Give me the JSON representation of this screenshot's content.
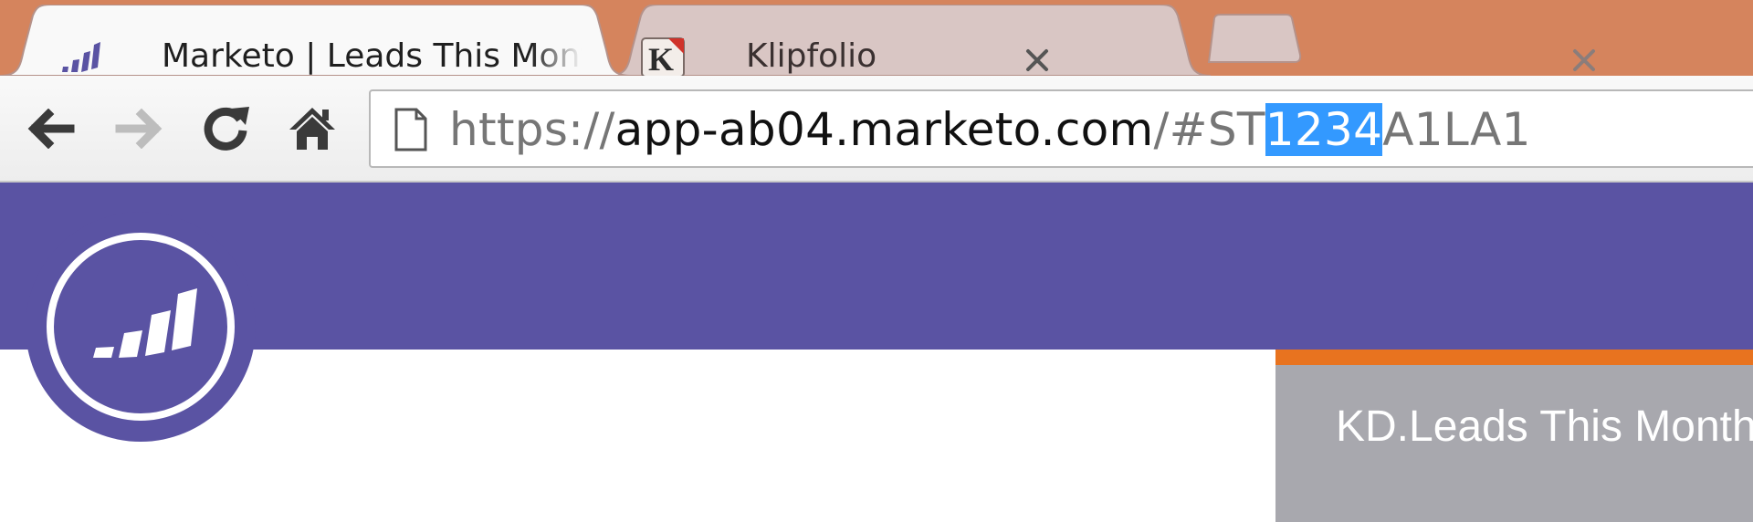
{
  "tabs": [
    {
      "title": "Marketo | Leads This Month",
      "favicon": "marketo-bars-icon",
      "active": true
    },
    {
      "title": "Klipfolio",
      "favicon": "klipfolio-k-icon",
      "active": false
    }
  ],
  "nav": {
    "back": "back-arrow-icon",
    "forward": "forward-arrow-icon",
    "reload": "reload-icon",
    "home": "home-icon"
  },
  "url": {
    "scheme": "https://",
    "host": "app-ab04.marketo.com",
    "path_prefix": "/#ST",
    "selected": "1234",
    "path_suffix": "A1LA1"
  },
  "panel": {
    "title": "KD.Leads This Month"
  },
  "colors": {
    "tabstrip": "#d5845d",
    "brand_purple": "#5a53a3",
    "selection": "#3399ff",
    "panel_gray": "#a8a8ae",
    "accent_orange": "#e8731f"
  }
}
